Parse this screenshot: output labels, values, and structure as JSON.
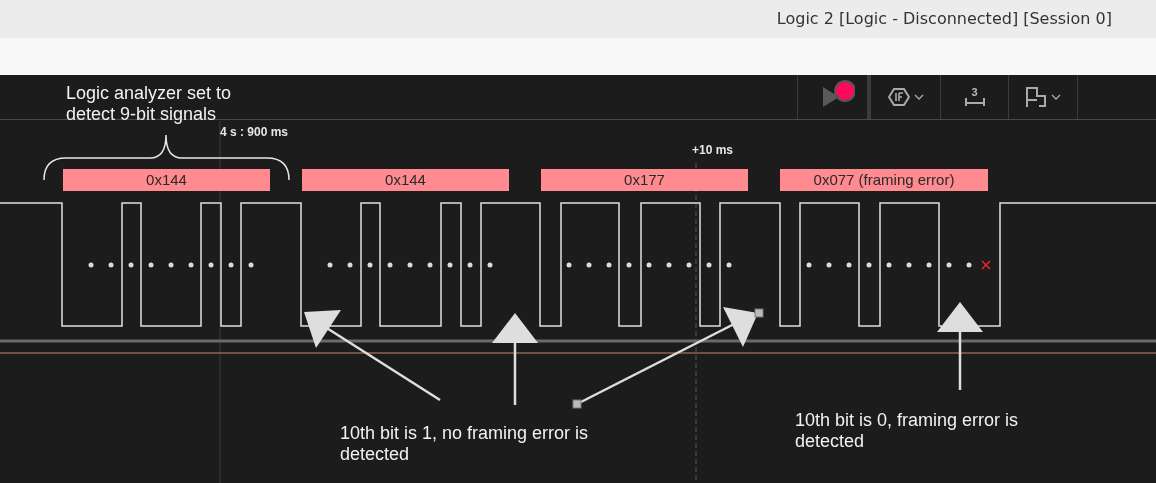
{
  "window": {
    "title": "Logic 2 [Logic - Disconnected] [Session 0]"
  },
  "toolbar": {
    "buttons": [
      {
        "kind": "record"
      },
      {
        "kind": "trigger"
      },
      {
        "kind": "measure",
        "label": "3"
      },
      {
        "kind": "layout"
      }
    ]
  },
  "timeline": {
    "markers": [
      {
        "label": "4 s : 900 ms"
      },
      {
        "label": "+10 ms"
      }
    ]
  },
  "frames": [
    {
      "value": "0x144",
      "framing_error": false
    },
    {
      "value": "0x144",
      "framing_error": false
    },
    {
      "value": "0x177",
      "framing_error": false
    },
    {
      "value": "0x077 (framing error)",
      "framing_error": true
    }
  ],
  "notes": [
    {
      "kind": "brace",
      "text": "Logic analyzer set to detect 9-bit signals"
    },
    {
      "kind": "note",
      "text": "10th bit is 1, no framing error is detected"
    },
    {
      "kind": "note",
      "text": "10th bit is 0, framing error is detected"
    }
  ]
}
